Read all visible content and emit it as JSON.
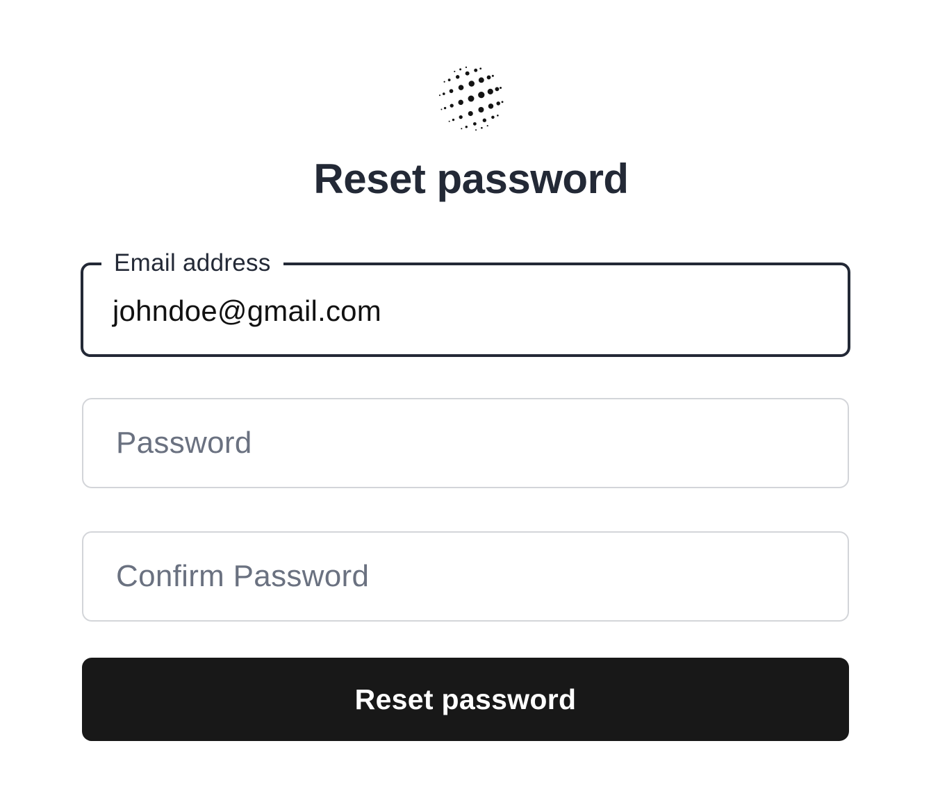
{
  "logo": {
    "icon": "dotted-sphere-icon"
  },
  "page": {
    "title": "Reset password"
  },
  "form": {
    "email": {
      "label": "Email address",
      "value": "johndoe@gmail.com"
    },
    "password": {
      "placeholder": "Password",
      "value": ""
    },
    "confirm_password": {
      "placeholder": "Confirm Password",
      "value": ""
    },
    "submit_label": "Reset password"
  },
  "colors": {
    "text": "#232936",
    "placeholder": "#6a7180",
    "border": "#d3d5d9",
    "focus_border": "#232936",
    "button_bg": "#181818",
    "button_text": "#ffffff"
  }
}
